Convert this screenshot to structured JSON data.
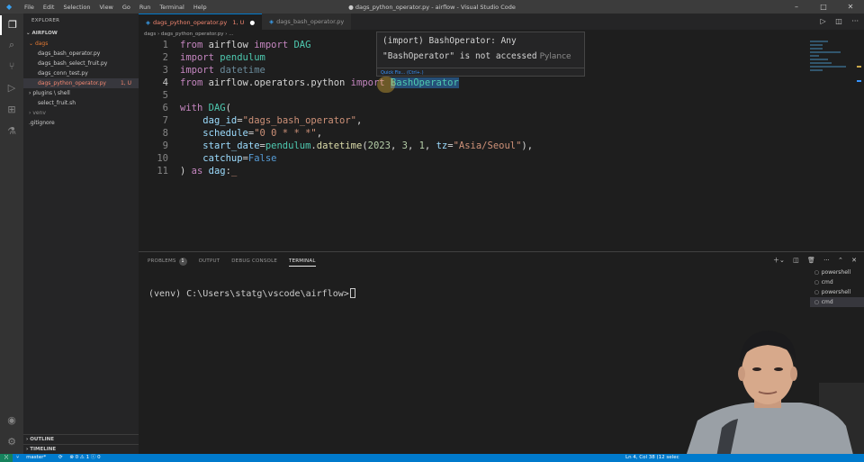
{
  "window": {
    "title": "● dags_python_operator.py - airflow - Visual Studio Code",
    "menu": [
      "File",
      "Edit",
      "Selection",
      "View",
      "Go",
      "Run",
      "Terminal",
      "Help"
    ]
  },
  "sidebar": {
    "title": "EXPLORER",
    "root": "AIRFLOW",
    "items": [
      {
        "label": "dags",
        "type": "folder-open"
      },
      {
        "label": "dags_bash_operator.py",
        "type": "file"
      },
      {
        "label": "dags_bash_select_fruit.py",
        "type": "file"
      },
      {
        "label": "dags_conn_test.py",
        "type": "file"
      },
      {
        "label": "dags_python_operator.py",
        "type": "file-selected",
        "badge": "1, U"
      },
      {
        "label": "plugins \\ shell",
        "type": "folder"
      },
      {
        "label": "select_fruit.sh",
        "type": "file"
      },
      {
        "label": "venv",
        "type": "folder-dim"
      },
      {
        "label": ".gitignore",
        "type": "file"
      }
    ],
    "outline": "OUTLINE",
    "timeline": "TIMELINE"
  },
  "tabs": [
    {
      "label": "dags_python_operator.py",
      "badge": "1, U",
      "dirty": "●",
      "active": true
    },
    {
      "label": "dags_bash_operator.py",
      "active": false
    }
  ],
  "breadcrumb": "dags › dags_python_operator.py › ...",
  "code": {
    "lines": [
      {
        "n": "1",
        "tokens": [
          [
            "kw",
            "from"
          ],
          [
            "plain",
            " "
          ],
          [
            "plain",
            "airflow"
          ],
          [
            "plain",
            " "
          ],
          [
            "kw",
            "import"
          ],
          [
            "plain",
            " "
          ],
          [
            "cls",
            "DAG"
          ]
        ]
      },
      {
        "n": "2",
        "tokens": [
          [
            "kw",
            "import"
          ],
          [
            "plain",
            " "
          ],
          [
            "cls",
            "pendulum"
          ]
        ]
      },
      {
        "n": "3",
        "tokens": [
          [
            "kw",
            "import"
          ],
          [
            "plain",
            " "
          ],
          [
            "faded",
            "datetime"
          ]
        ]
      },
      {
        "n": "4",
        "tokens": [
          [
            "kw",
            "from"
          ],
          [
            "plain",
            " "
          ],
          [
            "plain",
            "airflow.operators.python"
          ],
          [
            "plain",
            " "
          ],
          [
            "kw",
            "import"
          ],
          [
            "plain",
            " "
          ],
          [
            "hl",
            "BashOperator"
          ]
        ]
      },
      {
        "n": "5",
        "tokens": []
      },
      {
        "n": "6",
        "tokens": [
          [
            "kw",
            "with"
          ],
          [
            "plain",
            " "
          ],
          [
            "cls",
            "DAG"
          ],
          [
            "plain",
            "("
          ]
        ]
      },
      {
        "n": "7",
        "tokens": [
          [
            "plain",
            "    "
          ],
          [
            "var",
            "dag_id"
          ],
          [
            "plain",
            "="
          ],
          [
            "str",
            "\"dags_bash_operator\""
          ],
          [
            "plain",
            ","
          ]
        ]
      },
      {
        "n": "8",
        "tokens": [
          [
            "plain",
            "    "
          ],
          [
            "var",
            "schedule"
          ],
          [
            "plain",
            "="
          ],
          [
            "str",
            "\"0 0 * * *\""
          ],
          [
            "plain",
            ","
          ]
        ]
      },
      {
        "n": "9",
        "tokens": [
          [
            "plain",
            "    "
          ],
          [
            "var",
            "start_date"
          ],
          [
            "plain",
            "="
          ],
          [
            "cls",
            "pendulum"
          ],
          [
            "plain",
            "."
          ],
          [
            "fn",
            "datetime"
          ],
          [
            "plain",
            "("
          ],
          [
            "num",
            "2023"
          ],
          [
            "plain",
            ", "
          ],
          [
            "num",
            "3"
          ],
          [
            "plain",
            ", "
          ],
          [
            "num",
            "1"
          ],
          [
            "plain",
            ", "
          ],
          [
            "var",
            "tz"
          ],
          [
            "plain",
            "="
          ],
          [
            "str",
            "\"Asia/Seoul\""
          ],
          [
            "plain",
            "),"
          ]
        ]
      },
      {
        "n": "10",
        "tokens": [
          [
            "plain",
            "    "
          ],
          [
            "var",
            "catchup"
          ],
          [
            "plain",
            "="
          ],
          [
            "kw2",
            "False"
          ]
        ]
      },
      {
        "n": "11",
        "tokens": [
          [
            "plain",
            ") "
          ],
          [
            "kw",
            "as"
          ],
          [
            "plain",
            " "
          ],
          [
            "var",
            "dag"
          ],
          [
            "plain",
            ":"
          ],
          [
            "str",
            "_"
          ]
        ]
      }
    ]
  },
  "hover": {
    "line1": "(import) BashOperator: Any",
    "line2": "\"BashOperator\" is not accessed",
    "source": "Pylance",
    "quickfix": "Quick Fix... (Ctrl+.)"
  },
  "panel": {
    "tabs": [
      {
        "label": "PROBLEMS",
        "count": "1"
      },
      {
        "label": "OUTPUT"
      },
      {
        "label": "DEBUG CONSOLE"
      },
      {
        "label": "TERMINAL",
        "active": true
      }
    ],
    "terminal_prompt": "(venv) C:\\Users\\statg\\vscode\\airflow>",
    "terminals": [
      "powershell",
      "cmd",
      "powershell",
      "cmd"
    ]
  },
  "status": {
    "branch": "master*",
    "problems": "⊗ 0 ⚠ 1 ⓘ 0",
    "position": "Ln 4, Col 38 (12 selec"
  },
  "colors": {
    "accent": "#007acc",
    "modified": "#f48771",
    "keyword": "#c586c0",
    "class": "#4ec9b0",
    "string": "#ce9178"
  }
}
